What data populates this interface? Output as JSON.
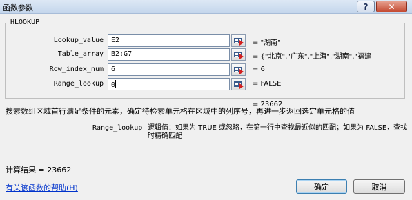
{
  "window": {
    "title": "函数参数",
    "help_glyph": "?",
    "close_glyph": "✕"
  },
  "group": {
    "label": "HLOOKUP"
  },
  "arguments": [
    {
      "name": "Lookup_value",
      "value": "E2",
      "result": "= \"湖南\""
    },
    {
      "name": "Table_array",
      "value": "B2:G7",
      "result": "= {\"北京\",\"广东\",\"上海\",\"湖南\",\"福建"
    },
    {
      "name": "Row_index_num",
      "value": "6",
      "result": "= 6"
    },
    {
      "name": "Range_lookup",
      "value": "0",
      "result": "= FALSE"
    }
  ],
  "formula_result": "= 23662",
  "description": "搜索数组区域首行满足条件的元素，确定待检索单元格在区域中的列序号，再进一步返回选定单元格的值",
  "param_help": {
    "name": "Range_lookup",
    "text": "逻辑值：如果为 TRUE 或忽略，在第一行中查找最近似的匹配；如果为 FALSE，查找时精确匹配"
  },
  "calc_result": "计算结果 =  23662",
  "help_link": "有关该函数的帮助(H)",
  "buttons": {
    "ok": "确定",
    "cancel": "取消"
  },
  "icons": {
    "ref_button": "collapse-dialog-icon"
  }
}
